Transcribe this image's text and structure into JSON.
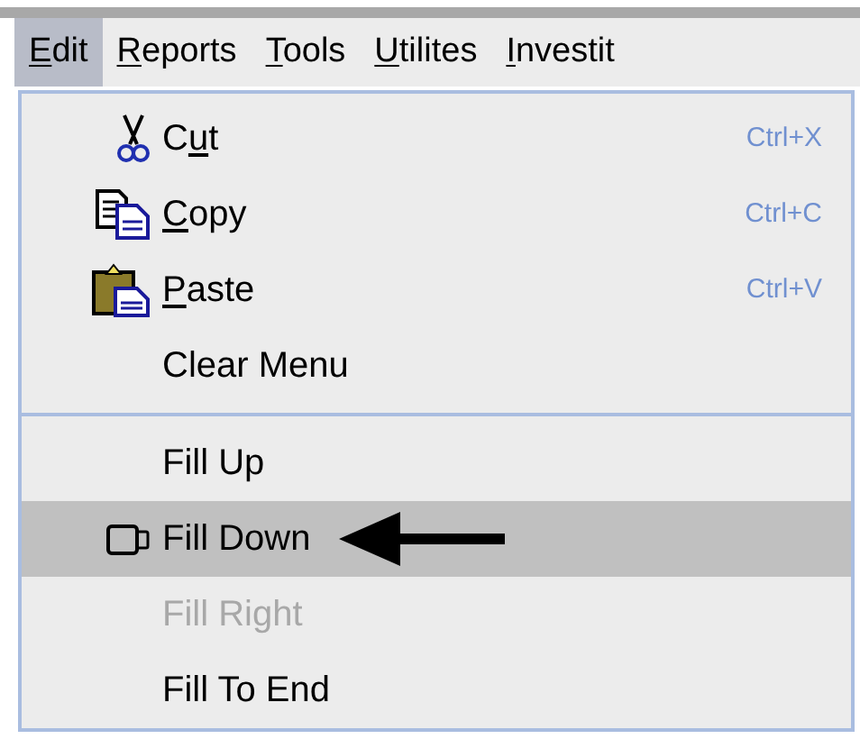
{
  "menu_bar": [
    {
      "mnemonic": "E",
      "after": "dit",
      "selected": true
    },
    {
      "mnemonic": "R",
      "after": "eports",
      "selected": false
    },
    {
      "mnemonic": "T",
      "after": "ools",
      "selected": false
    },
    {
      "mnemonic": "U",
      "after": "tilites",
      "selected": false
    },
    {
      "mnemonic": "I",
      "after": "nvestit",
      "selected": false
    }
  ],
  "menu": {
    "items": [
      {
        "kind": "item",
        "before": "C",
        "mnemonic": "u",
        "after": "t",
        "shortcut": "Ctrl+X",
        "selected": false,
        "disabled": false
      },
      {
        "kind": "item",
        "mnemonic": "C",
        "after": "opy",
        "shortcut": "Ctrl+C",
        "selected": false,
        "disabled": false
      },
      {
        "kind": "item",
        "mnemonic": "P",
        "after": "aste",
        "shortcut": "Ctrl+V",
        "selected": false,
        "disabled": false
      },
      {
        "kind": "item",
        "before": "Clear Menu",
        "selected": false,
        "disabled": false
      },
      {
        "kind": "separator"
      },
      {
        "kind": "item",
        "before": "Fill Up",
        "selected": false,
        "disabled": false
      },
      {
        "kind": "item",
        "before": "Fill Down",
        "selected": true,
        "disabled": false
      },
      {
        "kind": "item",
        "before": "Fill Right",
        "selected": false,
        "disabled": true
      },
      {
        "kind": "item",
        "before": "Fill To End",
        "selected": false,
        "disabled": false
      }
    ]
  }
}
